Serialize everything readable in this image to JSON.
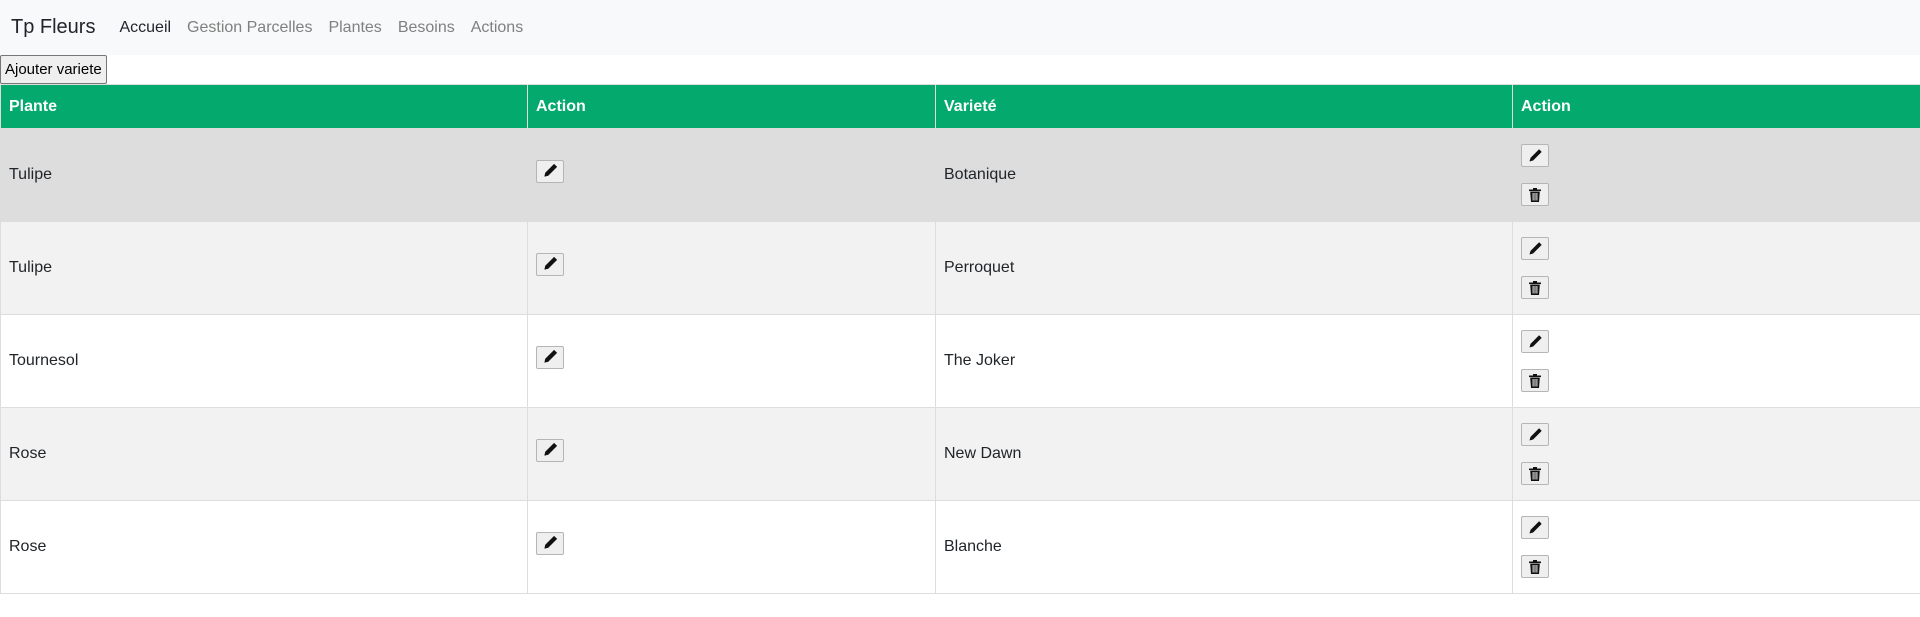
{
  "navbar": {
    "brand": "Tp Fleurs",
    "links": [
      "Accueil",
      "Gestion Parcelles",
      "Plantes",
      "Besoins",
      "Actions"
    ]
  },
  "add_button": "Ajouter variete",
  "table": {
    "headers": [
      "Plante",
      "Action",
      "Varieté",
      "Action"
    ],
    "rows": [
      {
        "plante": "Tulipe",
        "variete": "Botanique"
      },
      {
        "plante": "Tulipe",
        "variete": "Perroquet"
      },
      {
        "plante": "Tournesol",
        "variete": "The Joker"
      },
      {
        "plante": "Rose",
        "variete": "New Dawn"
      },
      {
        "plante": "Rose",
        "variete": "Blanche"
      }
    ]
  },
  "colors": {
    "header_bg": "#04aa6d",
    "hover_row": "#dddddd",
    "stripe": "#f2f2f2"
  },
  "icons": {
    "edit": "pencil-icon",
    "delete": "trash-icon"
  }
}
